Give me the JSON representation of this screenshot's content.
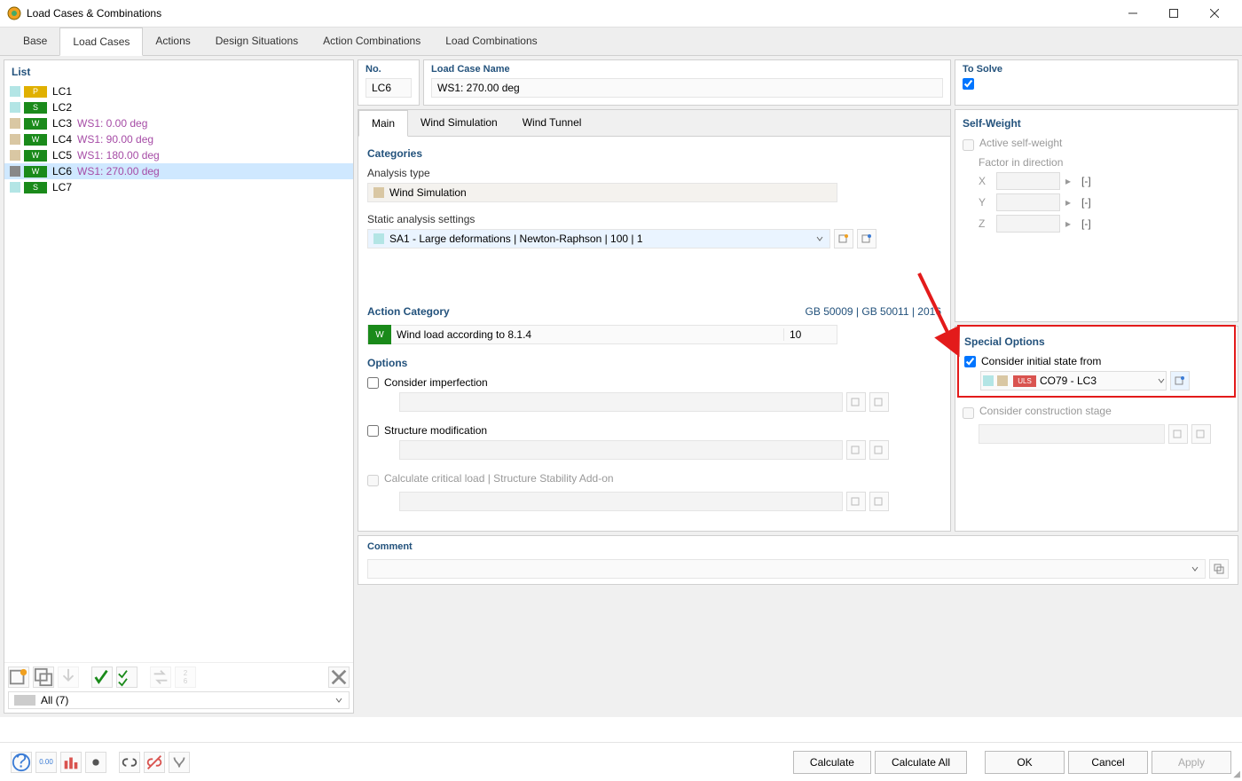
{
  "window": {
    "title": "Load Cases & Combinations"
  },
  "tabs": [
    "Base",
    "Load Cases",
    "Actions",
    "Design Situations",
    "Action Combinations",
    "Load Combinations"
  ],
  "active_tab": "Load Cases",
  "list": {
    "title": "List",
    "items": [
      {
        "chip": "cy",
        "badge": "P",
        "id": "LC1",
        "desc": "",
        "d": "n"
      },
      {
        "chip": "cy",
        "badge": "S",
        "id": "LC2",
        "desc": "",
        "d": "n"
      },
      {
        "chip": "w",
        "badge": "W",
        "id": "LC3",
        "desc": "WS1: 0.00 deg",
        "d": "p"
      },
      {
        "chip": "w",
        "badge": "W",
        "id": "LC4",
        "desc": "WS1: 90.00 deg",
        "d": "p"
      },
      {
        "chip": "w",
        "badge": "W",
        "id": "LC5",
        "desc": "WS1: 180.00 deg",
        "d": "p"
      },
      {
        "chip": "gy",
        "badge": "W",
        "id": "LC6",
        "desc": "WS1: 270.00 deg",
        "d": "p",
        "sel": true
      },
      {
        "chip": "cy",
        "badge": "S",
        "id": "LC7",
        "desc": "",
        "d": "n"
      }
    ],
    "filter": "All (7)"
  },
  "no": {
    "label": "No.",
    "value": "LC6"
  },
  "name": {
    "label": "Load Case Name",
    "value": "WS1: 270.00 deg"
  },
  "solve": {
    "label": "To Solve"
  },
  "subtabs": [
    "Main",
    "Wind Simulation",
    "Wind Tunnel"
  ],
  "categories": {
    "title": "Categories",
    "analysis_label": "Analysis type",
    "analysis_value": "Wind Simulation",
    "static_label": "Static analysis settings",
    "static_value": "SA1 - Large deformations | Newton-Raphson | 100 | 1"
  },
  "action_category": {
    "title": "Action Category",
    "code": "GB 50009 | GB 50011 | 2016",
    "badge": "W",
    "text": "Wind load according to 8.1.4",
    "num": "10"
  },
  "options": {
    "title": "Options",
    "imperfection": "Consider imperfection",
    "structure": "Structure modification",
    "critical": "Calculate critical load | Structure Stability Add-on"
  },
  "selfweight": {
    "title": "Self-Weight",
    "active": "Active self-weight",
    "factor": "Factor in direction",
    "x": "X",
    "y": "Y",
    "z": "Z",
    "unit": "[-]"
  },
  "special": {
    "title": "Special Options",
    "initial": "Consider initial state from",
    "combo_badge": "ULS",
    "combo_value": "CO79 - LC3",
    "construction": "Consider construction stage"
  },
  "comment": {
    "title": "Comment"
  },
  "buttons": {
    "calc": "Calculate",
    "calcall": "Calculate All",
    "ok": "OK",
    "cancel": "Cancel",
    "apply": "Apply"
  }
}
